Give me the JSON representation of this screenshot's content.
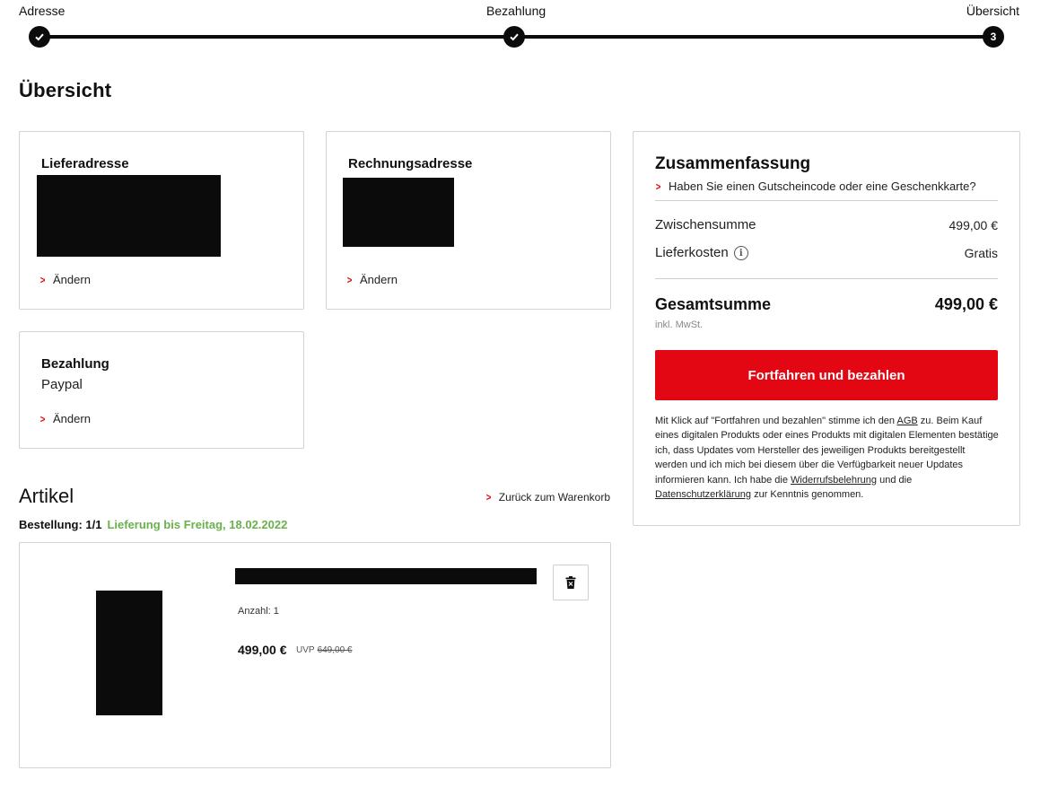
{
  "stepper": {
    "steps": [
      {
        "label": "Adresse",
        "state": "done"
      },
      {
        "label": "Bezahlung",
        "state": "done"
      },
      {
        "label": "Übersicht",
        "state": "current",
        "number": "3"
      }
    ]
  },
  "page_title": "Übersicht",
  "delivery": {
    "title": "Lieferadresse",
    "change_label": "Ändern"
  },
  "billing": {
    "title": "Rechnungsadresse",
    "change_label": "Ändern"
  },
  "payment": {
    "title": "Bezahlung",
    "method": "Paypal",
    "change_label": "Ändern"
  },
  "summary": {
    "title": "Zusammenfassung",
    "voucher_link": "Haben Sie einen Gutscheincode oder eine Geschenkkarte?",
    "subtotal_label": "Zwischensumme",
    "subtotal_value": "499,00 €",
    "shipping_label": "Lieferkosten",
    "shipping_value": "Gratis",
    "total_label": "Gesamtsumme",
    "total_value": "499,00 €",
    "tax_note": "inkl. MwSt.",
    "pay_button": "Fortfahren und bezahlen",
    "legal": {
      "p1": "Mit Klick auf \"Fortfahren und bezahlen\" stimme ich den ",
      "agb": "AGB",
      "p2": " zu. Beim Kauf eines digitalen Produkts oder eines Produkts mit digitalen Elementen bestätige ich, dass Updates vom Hersteller des jeweiligen Produkts bereitgestellt werden und ich mich bei diesem über die Verfügbarkeit neuer Updates informieren kann. Ich habe die ",
      "widerruf": "Widerrufsbelehrung",
      "p3": " und die ",
      "datenschutz": "Datenschutzerklärung",
      "p4": " zur Kenntnis genommen."
    }
  },
  "articles": {
    "title": "Artikel",
    "back_link": "Zurück zum Warenkorb",
    "order_label": "Bestellung: 1/1",
    "delivery_info": "Lieferung bis Freitag, 18.02.2022",
    "item": {
      "quantity": "Anzahl: 1",
      "price": "499,00 €",
      "uvp_label": "UVP",
      "uvp_price": "649,00 €"
    }
  },
  "colors": {
    "accent": "#e30613",
    "delivery_green": "#6ab04c",
    "redacted": "#0b0b0b"
  },
  "icons": [
    "check-icon",
    "chevron-right-icon",
    "info-icon",
    "trash-icon"
  ]
}
